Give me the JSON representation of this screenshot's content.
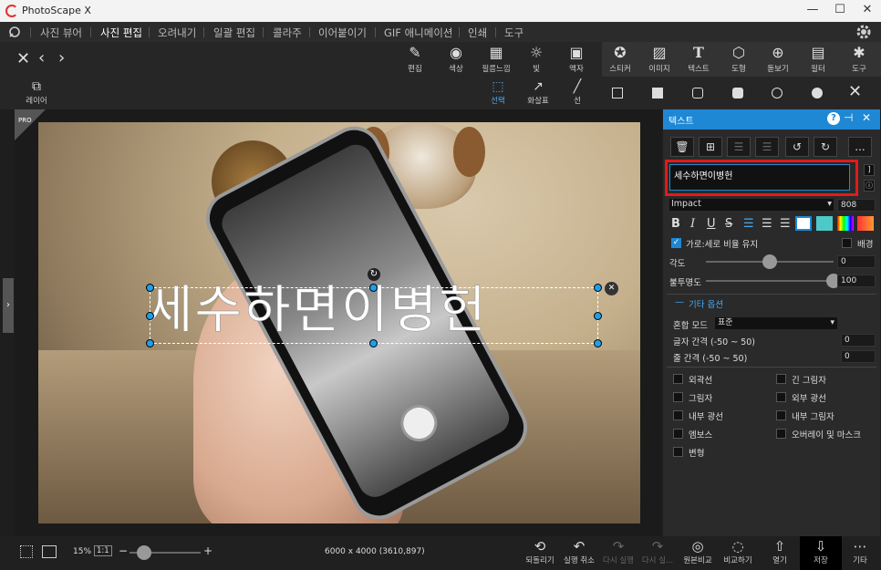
{
  "app": {
    "title": "PhotoScape X"
  },
  "window": {
    "minimize": "—",
    "maximize": "☐",
    "close": "✕"
  },
  "menu": {
    "items": [
      "사진 뷰어",
      "사진 편집",
      "오려내기",
      "일괄 편집",
      "콜라주",
      "이어붙이기",
      "GIF 애니메이션",
      "인쇄",
      "도구"
    ],
    "active": "사진 편집"
  },
  "toolbar": {
    "tools": [
      {
        "label": "편집",
        "icon": "edit-icon"
      },
      {
        "label": "색상",
        "icon": "color-icon"
      },
      {
        "label": "필름느낌",
        "icon": "film-icon"
      },
      {
        "label": "빛",
        "icon": "light-icon"
      },
      {
        "label": "액자",
        "icon": "frame-icon"
      },
      {
        "label": "스티커",
        "icon": "sticker-icon"
      },
      {
        "label": "이미지",
        "icon": "image-icon"
      },
      {
        "label": "텍스트",
        "icon": "text-icon"
      },
      {
        "label": "도형",
        "icon": "shape-icon"
      },
      {
        "label": "돋보기",
        "icon": "magnifier-icon"
      },
      {
        "label": "필터",
        "icon": "filter-icon"
      },
      {
        "label": "도구",
        "icon": "tools-icon"
      }
    ]
  },
  "subtoolbar": {
    "layer_label": "레이어",
    "select_label": "선택",
    "arrow_label": "화살표",
    "line_label": "선"
  },
  "canvas": {
    "badge": "PRO",
    "text_object": "세수하면이병헌"
  },
  "panel": {
    "title": "텍스트",
    "text_value": "세수하면이병헌",
    "font": "Impact",
    "font_size": "808",
    "more_label": "...",
    "keep_ratio_label": "가로:세로 비율 유지",
    "background_label": "배경",
    "angle_label": "각도",
    "angle_value": "0",
    "opacity_label": "불투명도",
    "opacity_value": "100",
    "opacity_fraction": 1.0,
    "angle_fraction": 0.5,
    "extra_options_label": "기타 옵션",
    "blend_mode_label": "혼합 모드",
    "blend_mode_value": "표준",
    "letter_spacing_label": "글자 간격 (-50 ~ 50)",
    "letter_spacing_value": "0",
    "line_spacing_label": "줄 간격 (-50 ~ 50)",
    "line_spacing_value": "0",
    "effects_left": [
      "외곽선",
      "그림자",
      "내부 광선",
      "엠보스",
      "변형"
    ],
    "effects_right": [
      "긴 그림자",
      "외부 광선",
      "내부 그림자",
      "오버레이 및 마스크"
    ]
  },
  "bottom": {
    "zoom_percent": "15%",
    "zoom_11": "1:1",
    "zoom_fraction": 0.2,
    "image_info": "6000 x 4000 (3610,897)",
    "actions": [
      {
        "label": "되돌리기",
        "icon": "revert-icon",
        "enabled": true
      },
      {
        "label": "실행 취소",
        "icon": "undo-icon",
        "enabled": true
      },
      {
        "label": "다시 실행",
        "icon": "redo-icon",
        "enabled": false
      },
      {
        "label": "다시 실...",
        "icon": "redo-all-icon",
        "enabled": false
      },
      {
        "label": "원본비교",
        "icon": "compare-original-icon",
        "enabled": true
      },
      {
        "label": "비교하기",
        "icon": "compare-icon",
        "enabled": true
      },
      {
        "label": "열기",
        "icon": "open-icon",
        "enabled": true
      },
      {
        "label": "저장",
        "icon": "save-icon",
        "enabled": true
      },
      {
        "label": "기타",
        "icon": "more-icon",
        "enabled": true
      }
    ]
  },
  "colors": {
    "accent": "#1e88d4",
    "highlight_box": "#e01b1b",
    "handle": "#1ea0e8"
  }
}
